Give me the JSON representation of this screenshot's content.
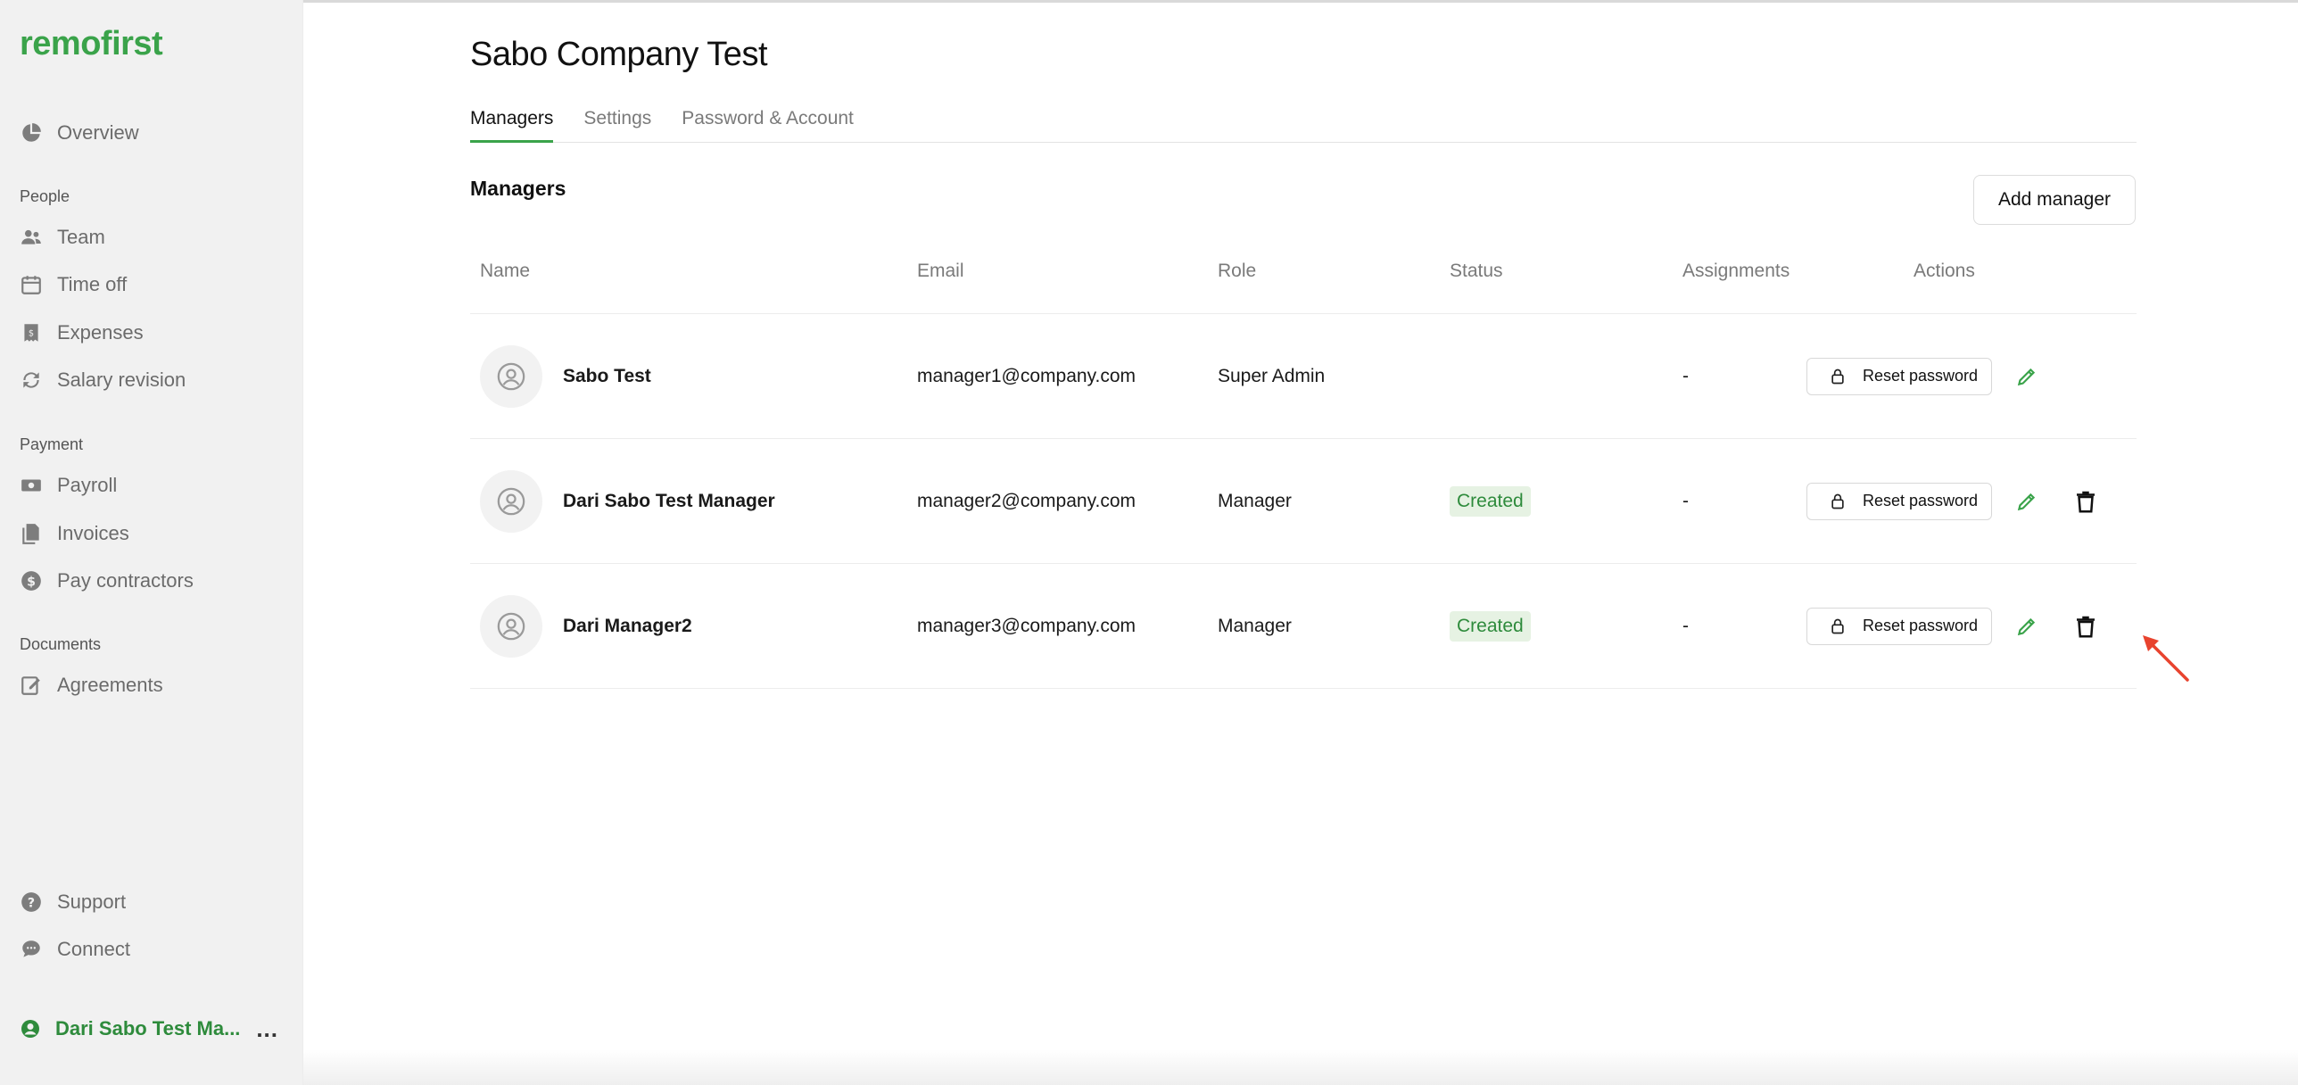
{
  "brand": {
    "logo_text": "remofirst",
    "accent_color": "#3aa34a"
  },
  "sidebar": {
    "overview": {
      "label": "Overview",
      "icon": "pie-chart-icon"
    },
    "sections": [
      {
        "label": "People",
        "items": [
          {
            "label": "Team",
            "icon": "team-icon"
          },
          {
            "label": "Time off",
            "icon": "calendar-icon"
          },
          {
            "label": "Expenses",
            "icon": "receipt-icon"
          },
          {
            "label": "Salary revision",
            "icon": "refresh-icon"
          }
        ]
      },
      {
        "label": "Payment",
        "items": [
          {
            "label": "Payroll",
            "icon": "cash-icon"
          },
          {
            "label": "Invoices",
            "icon": "documents-icon"
          },
          {
            "label": "Pay contractors",
            "icon": "dollar-circle-icon"
          }
        ]
      },
      {
        "label": "Documents",
        "items": [
          {
            "label": "Agreements",
            "icon": "edit-document-icon"
          }
        ]
      }
    ],
    "footer_items": [
      {
        "label": "Support",
        "icon": "help-circle-icon"
      },
      {
        "label": "Connect",
        "icon": "chat-icon"
      }
    ],
    "user": {
      "name": "Dari Sabo Test Ma...",
      "more": "..."
    }
  },
  "page": {
    "title": "Sabo Company Test",
    "tabs": [
      {
        "label": "Managers",
        "active": true
      },
      {
        "label": "Settings",
        "active": false
      },
      {
        "label": "Password & Account",
        "active": false
      }
    ],
    "section_title": "Managers",
    "add_button": "Add manager"
  },
  "table": {
    "columns": [
      "Name",
      "Email",
      "Role",
      "Status",
      "Assignments",
      "Actions"
    ],
    "rows": [
      {
        "name": "Sabo Test",
        "email": "manager1@company.com",
        "role": "Super Admin",
        "status": "",
        "assignments": "-",
        "reset_label": "Reset password",
        "deletable": false
      },
      {
        "name": "Dari Sabo Test Manager",
        "email": "manager2@company.com",
        "role": "Manager",
        "status": "Created",
        "assignments": "-",
        "reset_label": "Reset password",
        "deletable": true
      },
      {
        "name": "Dari Manager2",
        "email": "manager3@company.com",
        "role": "Manager",
        "status": "Created",
        "assignments": "-",
        "reset_label": "Reset password",
        "deletable": true
      }
    ]
  },
  "colors": {
    "status_badge_bg": "#e6f2e3",
    "status_badge_text": "#2e8b3c",
    "annotation_arrow": "#e8432e"
  }
}
